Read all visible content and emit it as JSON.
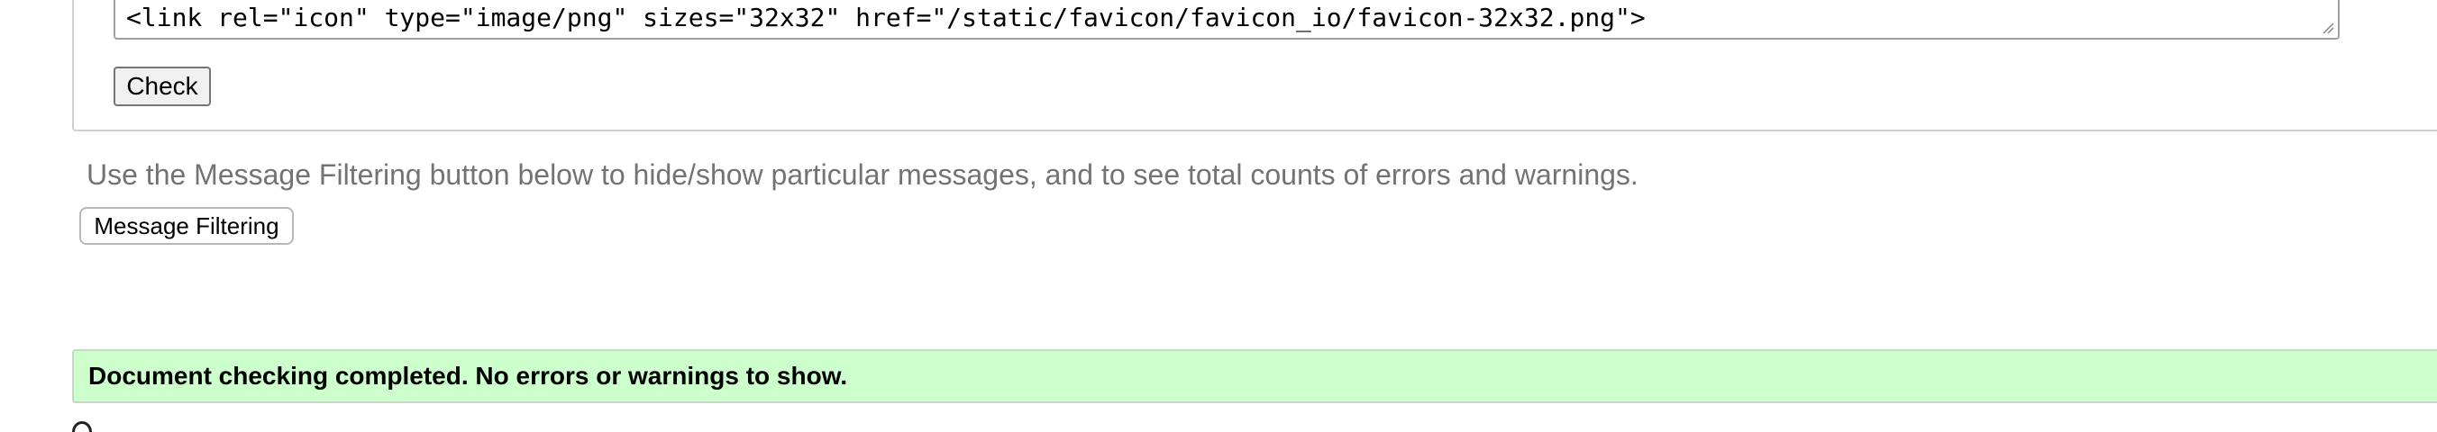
{
  "input_form": {
    "source_line": "<link rel=\"icon\" type=\"image/png\" sizes=\"32x32\" href=\"/static/favicon/favicon_io/favicon-32x32.png\">",
    "check_label": "Check"
  },
  "filtering": {
    "instructions": "Use the Message Filtering button below to hide/show particular messages, and to see total counts of errors and warnings.",
    "button_label": "Message Filtering"
  },
  "results": {
    "status_message": "Document checking completed. No errors or warnings to show.",
    "status_color": "#ccffcc"
  }
}
